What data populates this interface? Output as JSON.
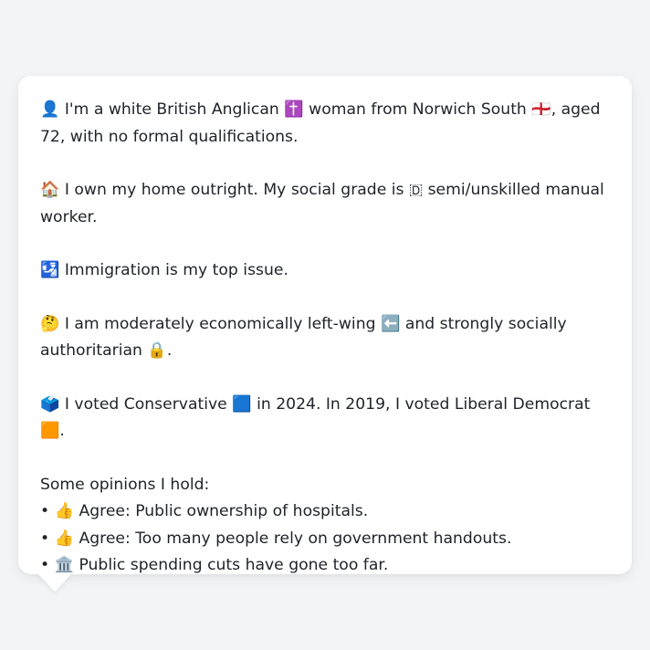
{
  "profile": {
    "paragraphs": [
      "👤 I'm a white British Anglican ✝️ woman from Norwich South 🏴󠁧󠁢󠁥󠁮󠁧󠁿, aged 72, with no formal qualifications.",
      "🏠 I own my home outright. My social grade is 🇩 semi/unskilled manual worker.",
      "🛂 Immigration is my top issue.",
      "🤔 I am moderately economically left-wing ⬅️ and strongly socially authoritarian 🔒.",
      "🗳️ I voted Conservative 🟦 in 2024. In 2019, I voted Liberal Democrat 🟧."
    ],
    "opinions_heading": "Some opinions I hold:",
    "opinions": [
      "• 👍 Agree: Public ownership of hospitals.",
      "• 👍 Agree: Too many people rely on government handouts.",
      "• 🏛️ Public spending cuts have gone too far."
    ]
  }
}
